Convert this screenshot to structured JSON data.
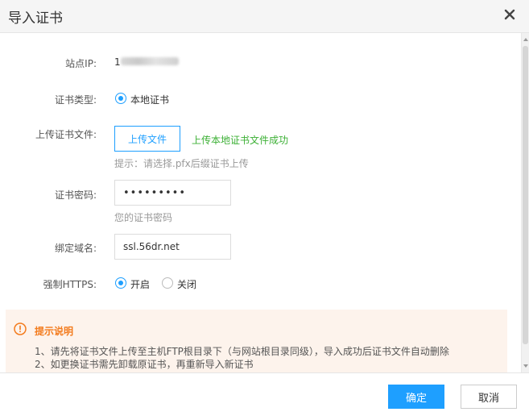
{
  "dialog": {
    "title": "导入证书",
    "close_icon": "close-icon"
  },
  "form": {
    "site_ip": {
      "label": "站点IP:",
      "value_prefix": "1"
    },
    "cert_type": {
      "label": "证书类型:",
      "option": "本地证书",
      "selected": true
    },
    "upload": {
      "label": "上传证书文件:",
      "button": "上传文件",
      "status": "上传本地证书文件成功",
      "hint": "提示：请选择.pfx后缀证书上传"
    },
    "password": {
      "label": "证书密码:",
      "value": "•••••••••",
      "hint": "您的证书密码"
    },
    "domain": {
      "label": "绑定域名:",
      "value": "ssl.56dr.net"
    },
    "https": {
      "label": "强制HTTPS:",
      "options": [
        {
          "label": "开启",
          "selected": true
        },
        {
          "label": "关闭",
          "selected": false
        }
      ]
    }
  },
  "notice": {
    "icon": "warning-circle-icon",
    "title": "提示说明",
    "lines": [
      "1、请先将证书文件上传至主机FTP根目录下（与网站根目录同级），导入成功后证书文件自动删除",
      "2、如更换证书需先卸载原证书，再重新导入新证书"
    ]
  },
  "footer": {
    "confirm": "确定",
    "cancel": "取消"
  },
  "colors": {
    "accent": "#1e9fff",
    "success": "#3cb035",
    "warning": "#f37b1d",
    "notice_bg": "#fdf3ec"
  }
}
